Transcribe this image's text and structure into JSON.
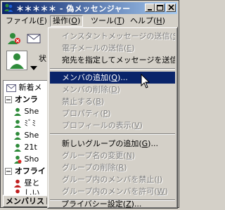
{
  "window": {
    "title": "＊＊＊＊＊ - 偽メッセンジャー",
    "title_bar_color": "#0a246a"
  },
  "menubar": {
    "items": [
      {
        "label": "ファイル(",
        "key": "F",
        "end": ")"
      },
      {
        "label": "操作(",
        "key": "O",
        "end": ")"
      },
      {
        "label": "ツール(",
        "key": "T",
        "end": ")"
      },
      {
        "label": "ヘルプ(",
        "key": "H",
        "end": ")"
      }
    ]
  },
  "left_panel": {
    "status_label": "状",
    "new_mail": "新着メ",
    "online_group": "オンラ",
    "contacts_online": [
      "She",
      "ﾐﾞﾐ",
      "She",
      "21t",
      "Sho"
    ],
    "offline_group": "オフライ",
    "contacts_offline": [
      "昼と",
      "しい"
    ],
    "tab_label": "メンバリスト"
  },
  "dropdown": {
    "items": [
      {
        "label": "インスタントメッセージの送信(",
        "key": "S",
        "end": ")...",
        "disabled": true
      },
      {
        "label": "電子メールの送信(",
        "key": "E",
        "end": ")",
        "disabled": true
      },
      {
        "label": "宛先を指定してメッセージを送信(",
        "key": "A",
        "end": ")...",
        "disabled": false
      },
      {
        "sep": true
      },
      {
        "label": "メンバの追加(",
        "key": "Q",
        "end": ")...",
        "disabled": false,
        "highlight": true
      },
      {
        "label": "メンバの削除(",
        "key": "D",
        "end": ")",
        "disabled": true
      },
      {
        "label": "禁止する(",
        "key": "B",
        "end": ")",
        "disabled": true
      },
      {
        "label": "プロパティ(",
        "key": "P",
        "end": ")",
        "disabled": true
      },
      {
        "label": "プロフィールの表示(",
        "key": "V",
        "end": ")",
        "disabled": true
      },
      {
        "sep": true
      },
      {
        "label": "新しいグループの追加(",
        "key": "G",
        "end": ")...",
        "disabled": false
      },
      {
        "label": "グループ名の変更(",
        "key": "N",
        "end": ")",
        "disabled": true
      },
      {
        "label": "グループの削除(",
        "key": "R",
        "end": ")",
        "disabled": true
      },
      {
        "label": "グループ内のメンバを禁止(",
        "key": "I",
        "end": ")",
        "disabled": true
      },
      {
        "label": "グループ内のメンバを許可(",
        "key": "W",
        "end": ")",
        "disabled": true
      },
      {
        "sep": true
      },
      {
        "label": "プライバシー設定(",
        "key": "Z",
        "end": ")...",
        "disabled": false
      }
    ]
  }
}
